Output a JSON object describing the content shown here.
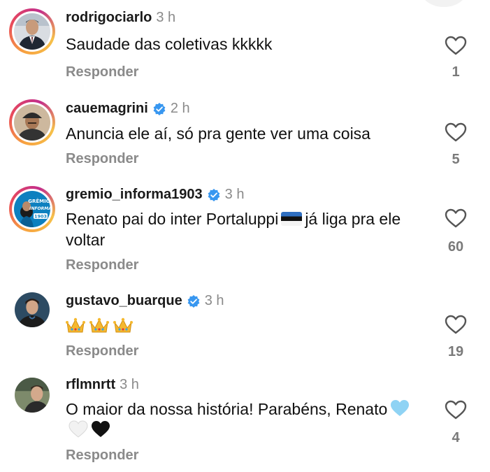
{
  "comments": [
    {
      "username": "rodrigociarlo",
      "verified": false,
      "time": "3 h",
      "text": "Saudade das coletivas kkkkk",
      "reply_label": "Responder",
      "likes": "1",
      "avatar": "man-in-suit-avatar"
    },
    {
      "username": "cauemagrini",
      "verified": true,
      "time": "2 h",
      "text": "Anuncia ele aí, só pra gente ver uma coisa",
      "reply_label": "Responder",
      "likes": "5",
      "avatar": "man-with-cap-avatar"
    },
    {
      "username": "gremio_informa1903",
      "verified": true,
      "time": "3 h",
      "text_before": "Renato pai do inter Portaluppi",
      "text_after": "já liga pra ele voltar",
      "reply_label": "Responder",
      "likes": "60",
      "avatar": "gremio-informa-logo-avatar"
    },
    {
      "username": "gustavo_buarque",
      "verified": true,
      "time": "3 h",
      "text": "",
      "reply_label": "Responder",
      "likes": "19",
      "avatar": "young-man-avatar"
    },
    {
      "username": "rflmnrtt",
      "verified": false,
      "time": "3 h",
      "text": "O maior da nossa história! Parabéns, Renato",
      "reply_label": "Responder",
      "likes": "4",
      "avatar": "man-in-stadium-avatar"
    }
  ],
  "colors": {
    "verified_blue": "#3897f0",
    "secondary_text": "#8a8a8a",
    "gremio_blue": "#0d80bf",
    "light_blue_heart": "#8fd3f4",
    "white_heart": "#f2f2f2",
    "black_heart": "#111111"
  },
  "icons": [
    "heart-outline-icon",
    "verified-badge-icon",
    "crown-emoji",
    "estonia-flag-emoji",
    "light-blue-heart-emoji",
    "white-heart-emoji",
    "black-heart-emoji"
  ]
}
